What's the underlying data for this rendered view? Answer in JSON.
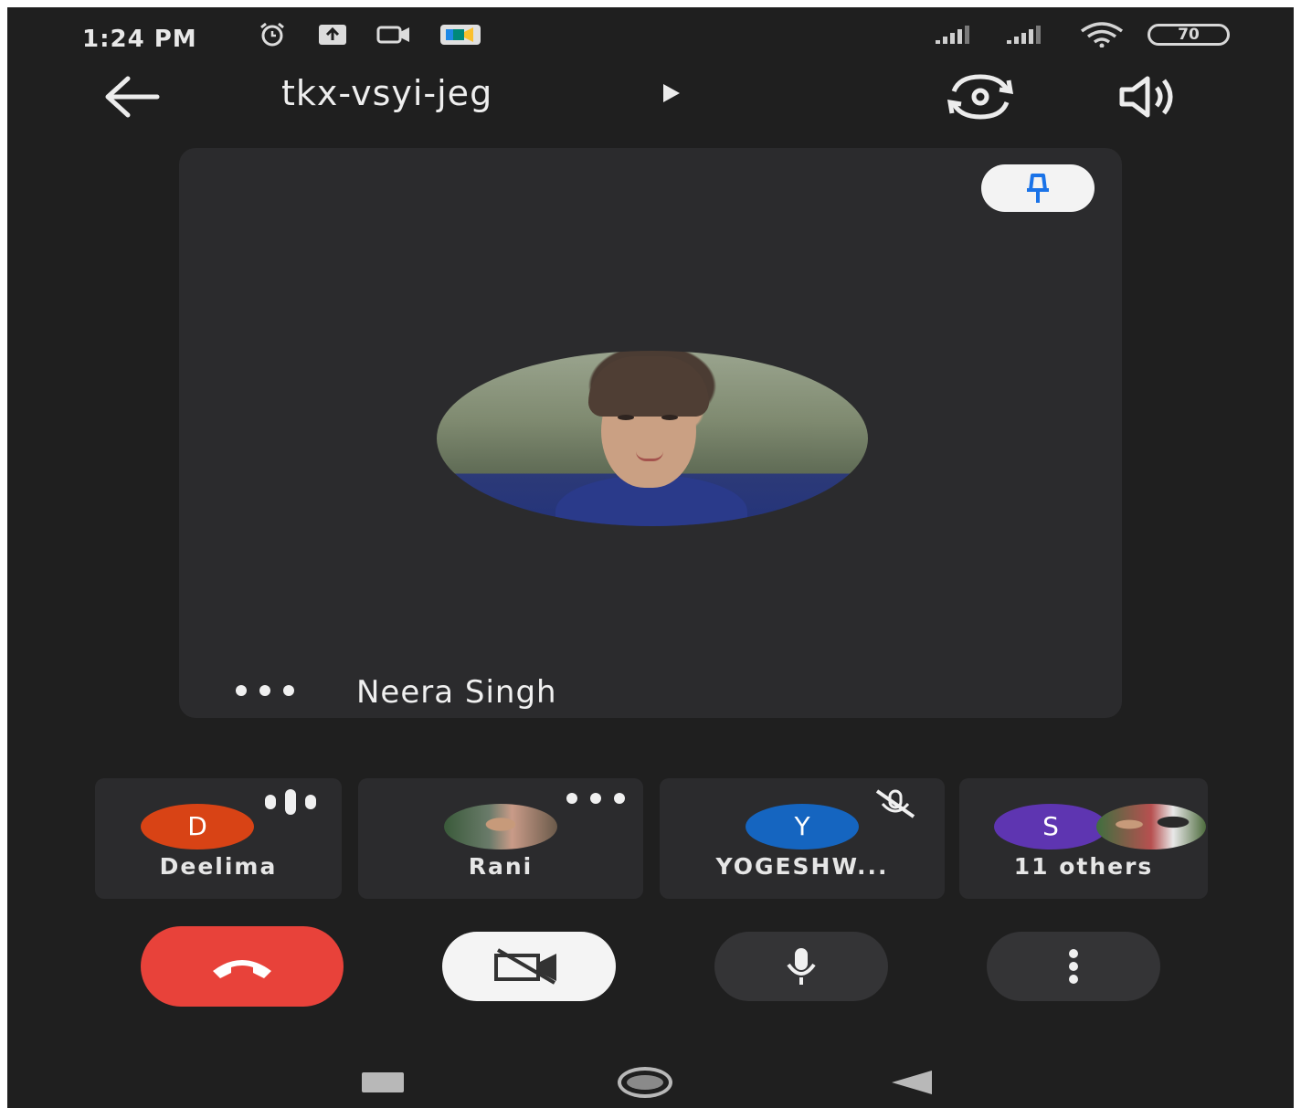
{
  "status_bar": {
    "time": "1:24 PM",
    "left_icons": [
      "alarm-icon",
      "upload-icon",
      "camera-icon",
      "meet-icon"
    ],
    "battery": "70"
  },
  "top_bar": {
    "meeting_code": "tkx-vsyi-jeg"
  },
  "main_tile": {
    "participant_name": "Neera Singh"
  },
  "participants": [
    {
      "initial": "D",
      "name": "Deelima",
      "color": "#d84315",
      "status": "speaking"
    },
    {
      "initial": "",
      "name": "Rani",
      "color": "",
      "status": "more"
    },
    {
      "initial": "Y",
      "name": "YOGESHW...",
      "color": "#1565c0",
      "status": "muted"
    },
    {
      "initial": "S",
      "name": "11 others",
      "color": "#5e35b1",
      "status": ""
    }
  ],
  "colors": {
    "background": "#1f1f1f",
    "tile": "#2b2b2d",
    "end_call": "#e8423a",
    "pin_icon": "#1a73e8"
  }
}
